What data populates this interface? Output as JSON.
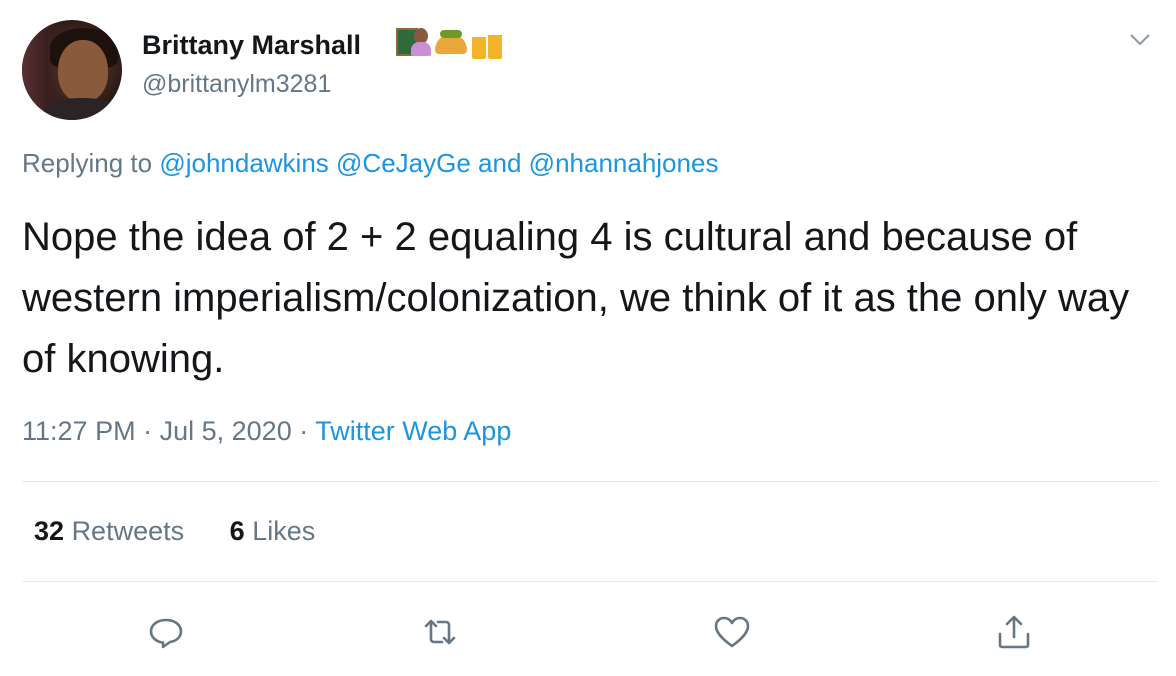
{
  "author": {
    "name": "Brittany Marshall",
    "handle": "@brittanylm3281",
    "name_emojis": [
      "teacher-emoji",
      "taco-emoji",
      "beer-mugs-emoji"
    ]
  },
  "reply": {
    "prefix": "Replying to",
    "mention_1": "@johndawkins",
    "mention_2": "@CeJayGe",
    "conjunction": "and",
    "mention_3": "@nhannahjones"
  },
  "tweet": {
    "text": "Nope the idea of 2 + 2 equaling 4 is cultural and because of western imperialism/colonization, we think of it as the only way of knowing."
  },
  "meta": {
    "time": "11:27 PM",
    "separator_1": "·",
    "date": "Jul 5, 2020",
    "separator_2": "·",
    "source": "Twitter Web App"
  },
  "stats": {
    "retweets_count": "32",
    "retweets_label": "Retweets",
    "likes_count": "6",
    "likes_label": "Likes"
  },
  "actions": [
    "reply-icon",
    "retweet-icon",
    "like-icon",
    "share-icon"
  ],
  "colors": {
    "text": "#14171a",
    "secondary": "#657786",
    "accent": "#1b95e0",
    "divider": "#e1e8ed"
  }
}
